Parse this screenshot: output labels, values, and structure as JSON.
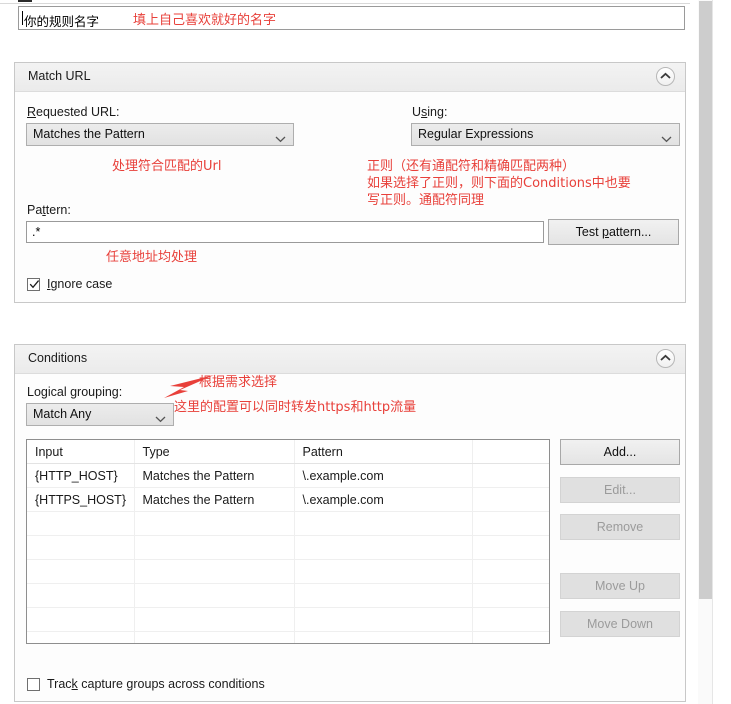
{
  "rule_name": {
    "value": "你的规则名字",
    "annotation": "填上自己喜欢就好的名字"
  },
  "match_url": {
    "title": "Match URL",
    "collapse_icon": "chevron-up-circle-icon",
    "requested_url_label_pre": "R",
    "requested_url_label_post": "equested URL:",
    "requested_url_value": "Matches the Pattern",
    "using_label_pre": "U",
    "using_label_mid": "s",
    "using_label_post": "ing:",
    "using_value": "Regular Expressions",
    "pattern_label_pre": "Pa",
    "pattern_label_mid": "t",
    "pattern_label_post": "tern:",
    "pattern_value": ".*",
    "test_pattern_pre": "Test ",
    "test_pattern_mid": "p",
    "test_pattern_post": "attern...",
    "ignore_case_pre": "I",
    "ignore_case_post": "gnore case",
    "ignore_case_checked": true,
    "annotation_left": "处理符合匹配的Url",
    "annotation_right": "正则（还有通配符和精确匹配两种）\n如果选择了正则，则下面的Conditions中也要\n写正则。通配符同理",
    "annotation_pattern": "任意地址均处理"
  },
  "conditions": {
    "title": "Conditions",
    "collapse_icon": "chevron-up-circle-icon",
    "logical_grouping_label_pre": "Logical ",
    "logical_grouping_label_mid": "g",
    "logical_grouping_label_post": "rouping:",
    "logical_grouping_value": "Match Any",
    "annotation_arrow": "根据需求选择",
    "annotation_note": "这里的配置可以同时转发https和http流量",
    "table": {
      "columns": [
        "Input",
        "Type",
        "Pattern",
        ""
      ],
      "rows": [
        [
          "{HTTP_HOST}",
          "Matches the Pattern",
          "\\.example.com",
          ""
        ],
        [
          "{HTTPS_HOST}",
          "Matches the Pattern",
          "\\.example.com",
          ""
        ],
        [
          "",
          "",
          "",
          ""
        ],
        [
          "",
          "",
          "",
          ""
        ],
        [
          "",
          "",
          "",
          ""
        ],
        [
          "",
          "",
          "",
          ""
        ],
        [
          "",
          "",
          "",
          ""
        ],
        [
          "",
          "",
          "",
          ""
        ]
      ]
    },
    "buttons": [
      {
        "label": "Add...",
        "enabled": true
      },
      {
        "label": "Edit...",
        "enabled": false
      },
      {
        "label": "Remove",
        "enabled": false
      },
      {
        "label": "Move Up",
        "enabled": false
      },
      {
        "label": "Move Down",
        "enabled": false
      }
    ],
    "track_capture_pre": "Trac",
    "track_capture_mid": "k",
    "track_capture_post": " capture groups across conditions",
    "track_capture_checked": false
  },
  "colors": {
    "annotation_red": "#e8403a",
    "panel_border": "#c8c8c8",
    "button_face": "#e4e4e4"
  }
}
